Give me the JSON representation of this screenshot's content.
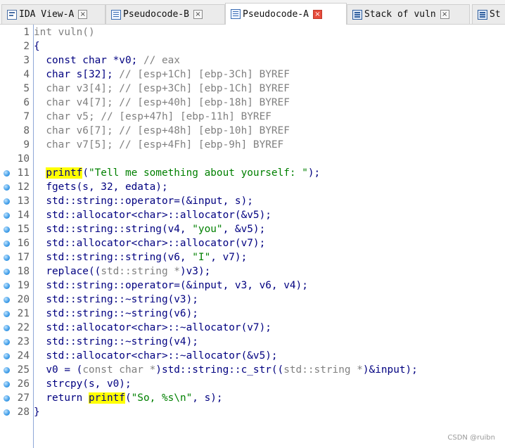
{
  "tabs": [
    {
      "label": "IDA View-A",
      "icon": "ida-view-icon",
      "active": false
    },
    {
      "label": "Pseudocode-B",
      "icon": "pseudocode-icon",
      "active": false
    },
    {
      "label": "Pseudocode-A",
      "icon": "pseudocode-icon",
      "active": true
    },
    {
      "label": "Stack of vuln",
      "icon": "stack-icon",
      "active": false
    },
    {
      "label": "St",
      "icon": "stack-icon",
      "active": false
    }
  ],
  "close_glyph": "×",
  "lines": [
    {
      "num": "1",
      "bp": false,
      "segs": [
        [
          "int vuln()",
          "gray"
        ]
      ]
    },
    {
      "num": "2",
      "bp": false,
      "segs": [
        [
          "{",
          "navy"
        ]
      ]
    },
    {
      "num": "3",
      "bp": false,
      "segs": [
        [
          "  const char *v0; ",
          "navy"
        ],
        [
          "// eax",
          "gray"
        ]
      ]
    },
    {
      "num": "4",
      "bp": false,
      "segs": [
        [
          "  char s[32]; ",
          "navy"
        ],
        [
          "// [esp+1Ch] [ebp-3Ch] BYREF",
          "gray"
        ]
      ]
    },
    {
      "num": "5",
      "bp": false,
      "segs": [
        [
          "  char v3[4]; ",
          "gray"
        ],
        [
          "// [esp+3Ch] [ebp-1Ch] BYREF",
          "gray"
        ]
      ]
    },
    {
      "num": "6",
      "bp": false,
      "segs": [
        [
          "  char v4[7]; ",
          "gray"
        ],
        [
          "// [esp+40h] [ebp-18h] BYREF",
          "gray"
        ]
      ]
    },
    {
      "num": "7",
      "bp": false,
      "segs": [
        [
          "  char v5; ",
          "gray"
        ],
        [
          "// [esp+47h] [ebp-11h] BYREF",
          "gray"
        ]
      ]
    },
    {
      "num": "8",
      "bp": false,
      "segs": [
        [
          "  char v6[7]; ",
          "gray"
        ],
        [
          "// [esp+48h] [ebp-10h] BYREF",
          "gray"
        ]
      ]
    },
    {
      "num": "9",
      "bp": false,
      "segs": [
        [
          "  char v7[5]; ",
          "gray"
        ],
        [
          "// [esp+4Fh] [ebp-9h] BYREF",
          "gray"
        ]
      ]
    },
    {
      "num": "10",
      "bp": false,
      "segs": []
    },
    {
      "num": "11",
      "bp": true,
      "segs": [
        [
          "  ",
          "navy"
        ],
        [
          "printf",
          "hl"
        ],
        [
          "(",
          "navy"
        ],
        [
          "\"Tell me something about yourself: \"",
          "green"
        ],
        [
          ");",
          "navy"
        ]
      ]
    },
    {
      "num": "12",
      "bp": true,
      "segs": [
        [
          "  fgets(s, 32, edata);",
          "navy"
        ]
      ]
    },
    {
      "num": "13",
      "bp": true,
      "segs": [
        [
          "  std::string::operator=(&input, s);",
          "navy"
        ]
      ]
    },
    {
      "num": "14",
      "bp": true,
      "segs": [
        [
          "  std::allocator<char>::allocator(&v5);",
          "navy"
        ]
      ]
    },
    {
      "num": "15",
      "bp": true,
      "segs": [
        [
          "  std::string::string(v4, ",
          "navy"
        ],
        [
          "\"you\"",
          "green"
        ],
        [
          ", &v5);",
          "navy"
        ]
      ]
    },
    {
      "num": "16",
      "bp": true,
      "segs": [
        [
          "  std::allocator<char>::allocator(v7);",
          "navy"
        ]
      ]
    },
    {
      "num": "17",
      "bp": true,
      "segs": [
        [
          "  std::string::string(v6, ",
          "navy"
        ],
        [
          "\"I\"",
          "green"
        ],
        [
          ", v7);",
          "navy"
        ]
      ]
    },
    {
      "num": "18",
      "bp": true,
      "segs": [
        [
          "  replace((",
          "navy"
        ],
        [
          "std::string *",
          "gray"
        ],
        [
          ")v3);",
          "navy"
        ]
      ]
    },
    {
      "num": "19",
      "bp": true,
      "segs": [
        [
          "  std::string::operator=(&input, v3, v6, v4);",
          "navy"
        ]
      ]
    },
    {
      "num": "20",
      "bp": true,
      "segs": [
        [
          "  std::string::~string(v3);",
          "navy"
        ]
      ]
    },
    {
      "num": "21",
      "bp": true,
      "segs": [
        [
          "  std::string::~string(v6);",
          "navy"
        ]
      ]
    },
    {
      "num": "22",
      "bp": true,
      "segs": [
        [
          "  std::allocator<char>::~allocator(v7);",
          "navy"
        ]
      ]
    },
    {
      "num": "23",
      "bp": true,
      "segs": [
        [
          "  std::string::~string(v4);",
          "navy"
        ]
      ]
    },
    {
      "num": "24",
      "bp": true,
      "segs": [
        [
          "  std::allocator<char>::~allocator(&v5);",
          "navy"
        ]
      ]
    },
    {
      "num": "25",
      "bp": true,
      "segs": [
        [
          "  v0 = (",
          "navy"
        ],
        [
          "const char *",
          "gray"
        ],
        [
          ")std::string::c_str((",
          "navy"
        ],
        [
          "std::string *",
          "gray"
        ],
        [
          ")&input);",
          "navy"
        ]
      ]
    },
    {
      "num": "26",
      "bp": true,
      "segs": [
        [
          "  strcpy(s, v0);",
          "navy"
        ]
      ]
    },
    {
      "num": "27",
      "bp": true,
      "segs": [
        [
          "  return ",
          "navy"
        ],
        [
          "printf",
          "hl"
        ],
        [
          "(",
          "navy"
        ],
        [
          "\"So, %s\\n\"",
          "green"
        ],
        [
          ", s);",
          "navy"
        ]
      ]
    },
    {
      "num": "28",
      "bp": true,
      "segs": [
        [
          "}",
          "navy"
        ]
      ]
    }
  ],
  "watermark": "CSDN @ruibn",
  "colors": {
    "navy": "#000080",
    "green": "#008000",
    "gray": "#808080",
    "highlight": "#ffff00",
    "breakpoint": "#3f9de8"
  }
}
